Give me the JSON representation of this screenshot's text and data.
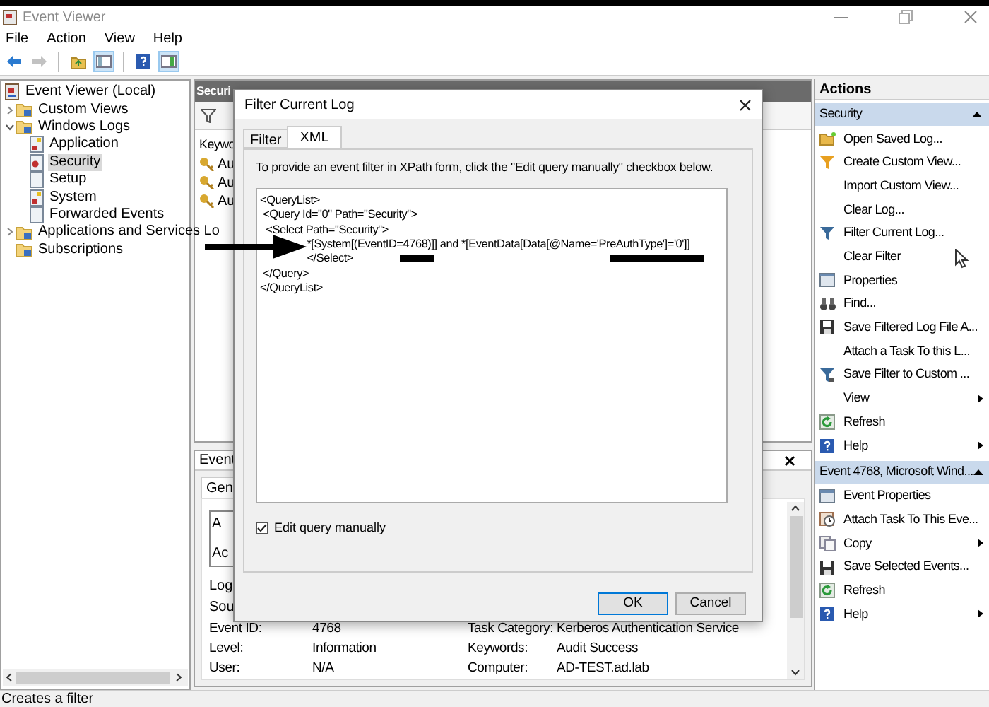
{
  "window": {
    "title": "Event Viewer"
  },
  "menu": [
    "File",
    "Action",
    "View",
    "Help"
  ],
  "toolbar": [
    {
      "kind": "back",
      "disabled": false,
      "on": false
    },
    {
      "kind": "forward",
      "disabled": true,
      "on": false
    },
    {
      "kind": "up",
      "disabled": false,
      "on": false
    },
    {
      "kind": "console_tree",
      "disabled": false,
      "on": true
    },
    {
      "kind": "help",
      "disabled": false,
      "on": false
    },
    {
      "kind": "action_pane",
      "disabled": false,
      "on": true
    }
  ],
  "tree": [
    {
      "label": "Event Viewer (Local)",
      "kind": "root",
      "selected": false,
      "children": [
        {
          "label": "Custom Views",
          "kind": "folder",
          "expanded": false,
          "selected": false
        },
        {
          "label": "Windows Logs",
          "kind": "folder",
          "expanded": true,
          "selected": false,
          "children": [
            {
              "label": "Application",
              "kind": "log_warn",
              "selected": false
            },
            {
              "label": "Security",
              "kind": "log_sec",
              "selected": true
            },
            {
              "label": "Setup",
              "kind": "log",
              "selected": false
            },
            {
              "label": "System",
              "kind": "log_warn",
              "selected": false
            },
            {
              "label": "Forwarded Events",
              "kind": "log",
              "selected": false
            }
          ]
        },
        {
          "label": "Applications and Services Lo",
          "kind": "folder",
          "expanded": false,
          "selected": false
        },
        {
          "label": "Subscriptions",
          "kind": "folder",
          "selected": false
        }
      ]
    }
  ],
  "event_list": {
    "header": "Securi",
    "column_1": "Keywo",
    "rows": [
      "Au",
      "Au",
      "Au"
    ]
  },
  "event_details": {
    "header": "Event",
    "tabs": [
      {
        "label": "Gen",
        "selected": true
      }
    ],
    "description": [
      "A",
      "Ac"
    ],
    "fields": [
      "Log",
      "Sou"
    ],
    "properties": [
      {
        "label": "Event ID:",
        "value": "4768",
        "label_2": "Task Category:",
        "value_2": "Kerberos Authentication Service"
      },
      {
        "label": "Level:",
        "value": "Information",
        "label_2": "Keywords:",
        "value_2": "Audit Success"
      },
      {
        "label": "User:",
        "value": "N/A",
        "label_2": "Computer:",
        "value_2": "AD-TEST.ad.lab"
      }
    ]
  },
  "dialog": {
    "title": "Filter Current Log",
    "tabs": [
      {
        "label": "Filter",
        "selected": false
      },
      {
        "label": "XML",
        "selected": true
      }
    ],
    "instructions": "To provide an event filter in XPath form, click the \"Edit query manually\" checkbox below.",
    "query": "<QueryList>\n <Query Id=\"0\" Path=\"Security\">\n  <Select Path=\"Security\">\n                *[System[(EventID=4768)]] and *[EventData[Data[@Name='PreAuthType']='0']]\n                </Select>\n </Query>\n</QueryList>",
    "edit_manually": {
      "label": "Edit query manually",
      "checked": true
    },
    "buttons": [
      {
        "label": "OK",
        "default": true
      },
      {
        "label": "Cancel",
        "default": false
      }
    ]
  },
  "actions": {
    "header": "Actions",
    "sections": [
      {
        "title": "Security",
        "expanded": true,
        "selected": false,
        "items": [
          {
            "label": "Open Saved Log...",
            "kind": "open_log",
            "submenu": false
          },
          {
            "label": "Create Custom View...",
            "kind": "custom_view",
            "submenu": false
          },
          {
            "label": "Import Custom View...",
            "kind": "plain",
            "submenu": false
          },
          {
            "label": "Clear Log...",
            "kind": "plain",
            "submenu": false
          },
          {
            "label": "Filter Current Log...",
            "kind": "filter",
            "submenu": false
          },
          {
            "label": "Clear Filter",
            "kind": "plain",
            "submenu": false
          },
          {
            "label": "Properties",
            "kind": "properties",
            "submenu": false
          },
          {
            "label": "Find...",
            "kind": "find",
            "submenu": false
          },
          {
            "label": "Save Filtered Log File A...",
            "kind": "save",
            "submenu": false
          },
          {
            "label": "Attach a Task To this L...",
            "kind": "plain",
            "submenu": false
          },
          {
            "label": "Save Filter to Custom ...",
            "kind": "save_filter",
            "submenu": false
          },
          {
            "label": "View",
            "kind": "plain",
            "submenu": true
          },
          {
            "label": "Refresh",
            "kind": "refresh",
            "submenu": false
          },
          {
            "label": "Help",
            "kind": "help",
            "submenu": true
          }
        ]
      },
      {
        "title": "Event 4768, Microsoft Wind...",
        "expanded": true,
        "selected": false,
        "items": [
          {
            "label": "Event Properties",
            "kind": "properties",
            "submenu": false
          },
          {
            "label": "Attach Task To This Eve...",
            "kind": "attach_task",
            "submenu": false
          },
          {
            "label": "Copy",
            "kind": "copy",
            "submenu": true
          },
          {
            "label": "Save Selected Events...",
            "kind": "save",
            "submenu": false
          },
          {
            "label": "Refresh",
            "kind": "refresh",
            "submenu": false
          },
          {
            "label": "Help",
            "kind": "help",
            "submenu": true
          }
        ]
      }
    ]
  },
  "status_bar": "Creates a filter"
}
